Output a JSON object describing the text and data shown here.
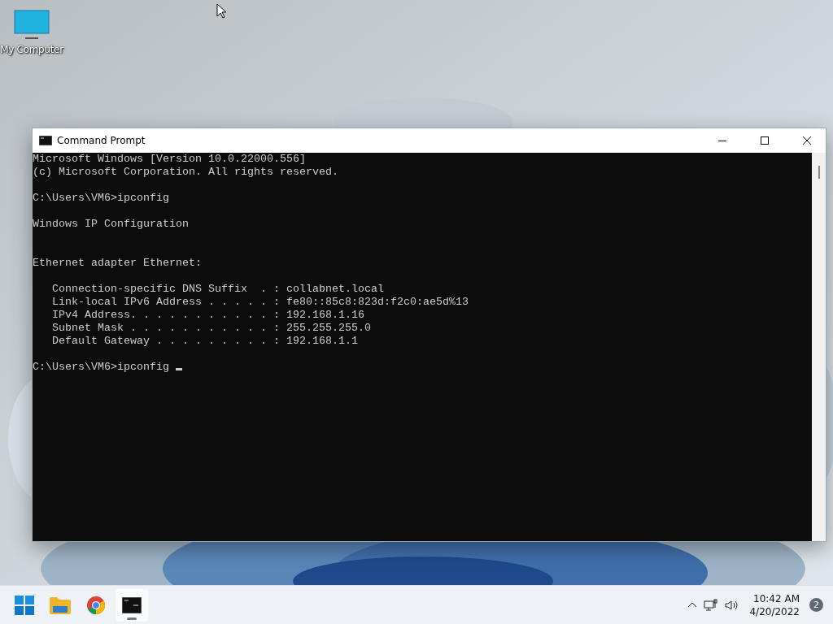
{
  "desktop": {
    "icons": [
      {
        "label": "My Computer"
      }
    ]
  },
  "window": {
    "title": "Command Prompt",
    "active": true,
    "console": {
      "blocks": [
        {
          "kind": "output",
          "lines": [
            "Microsoft Windows [Version 10.0.22000.556]",
            "(c) Microsoft Corporation. All rights reserved."
          ]
        },
        {
          "kind": "output",
          "lines": [
            "C:\\Users\\VM6>ipconfig"
          ]
        },
        {
          "kind": "output",
          "lines": [
            "Windows IP Configuration"
          ]
        },
        {
          "kind": "section",
          "lines": [
            "Ethernet adapter Ethernet:"
          ]
        },
        {
          "kind": "output",
          "lines": [
            "   Connection-specific DNS Suffix  . : collabnet.local",
            "   Link-local IPv6 Address . . . . . : fe80::85c8:823d:f2c0:ae5d%13",
            "   IPv4 Address. . . . . . . . . . . : 192.168.1.16",
            "   Subnet Mask . . . . . . . . . . . : 255.255.255.0",
            "   Default Gateway . . . . . . . . . : 192.168.1.1"
          ]
        }
      ],
      "prompt": "C:\\Users\\VM6>ipconfig "
    }
  },
  "taskbar": {
    "apps": [
      {
        "kind": "start",
        "selected": false
      },
      {
        "kind": "folder",
        "selected": false
      },
      {
        "kind": "browser",
        "selected": false
      },
      {
        "kind": "terminal",
        "selected": true
      }
    ],
    "clock": {
      "time": "10:42 AM",
      "date": "4/20/2022"
    },
    "notifications": "2"
  }
}
